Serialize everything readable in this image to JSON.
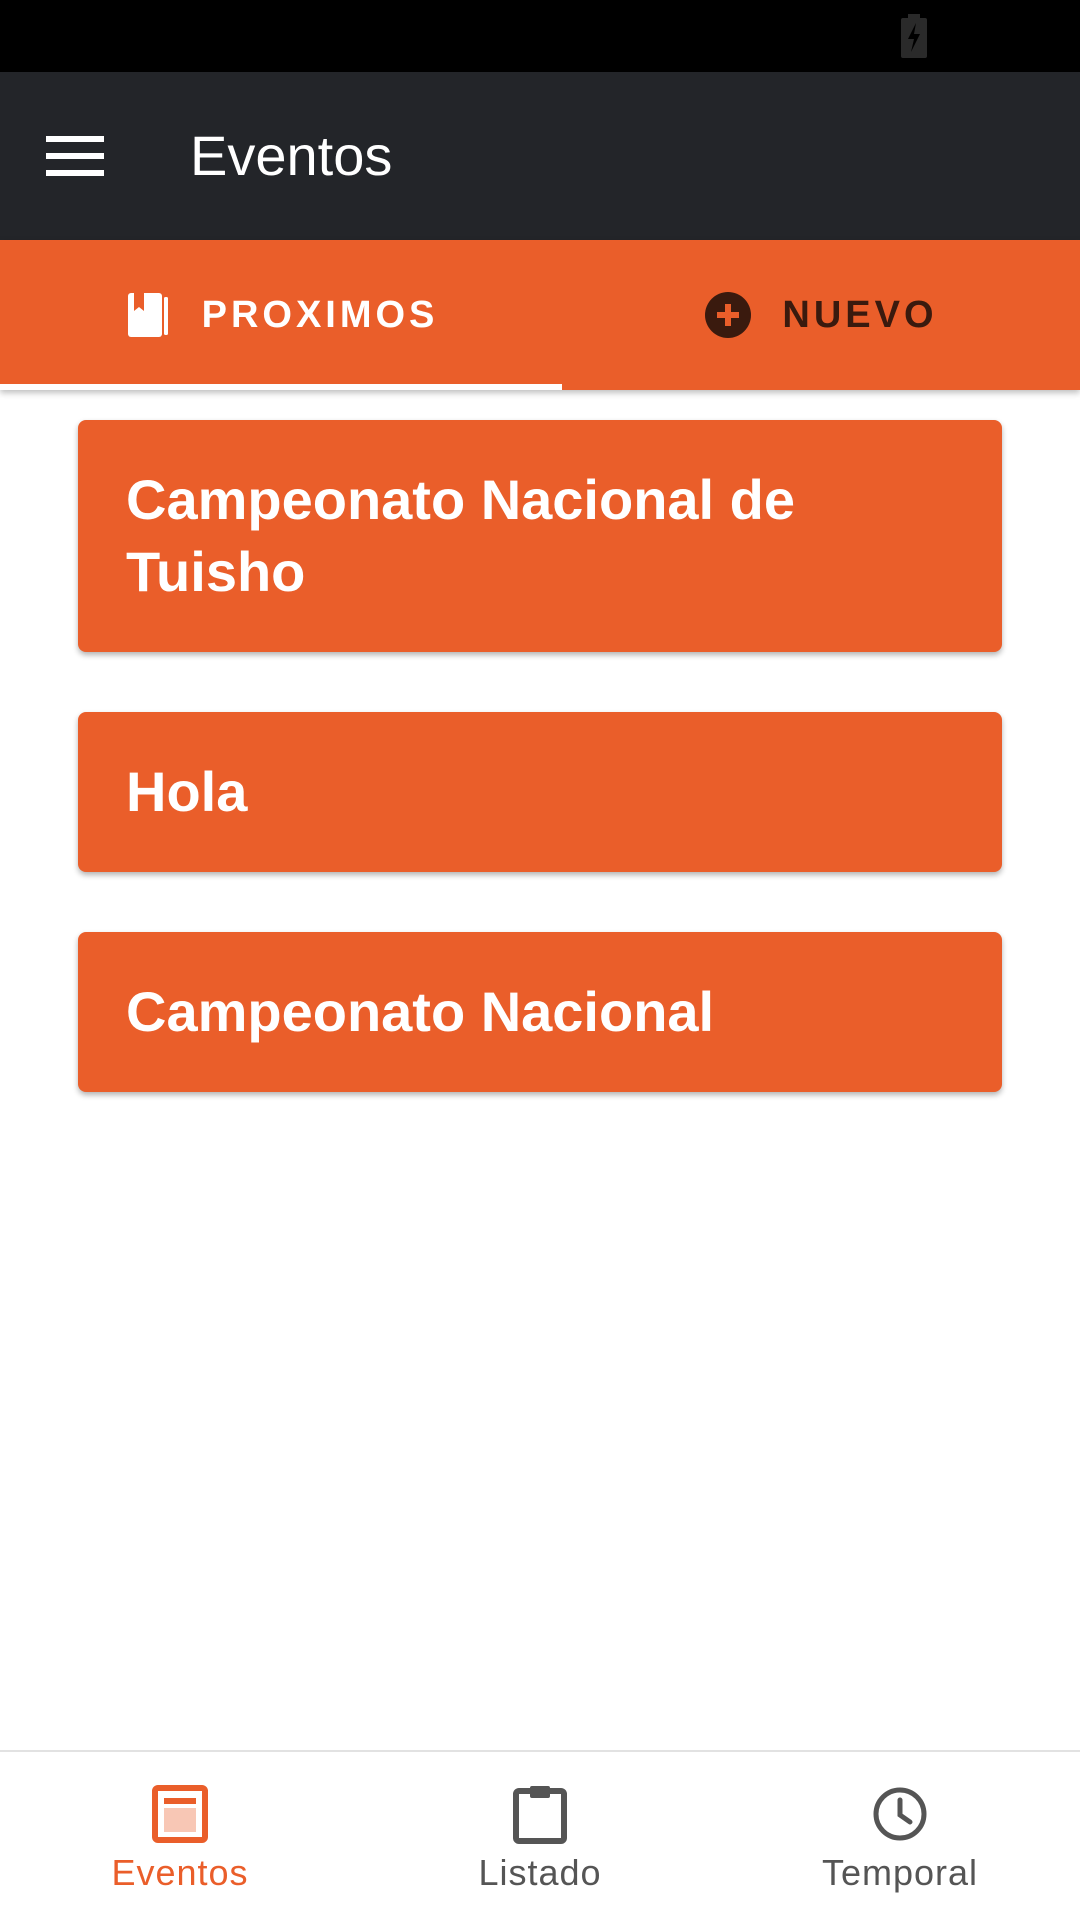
{
  "app_bar": {
    "title": "Eventos",
    "menu_icon": "hamburger-menu-icon",
    "color": "#232529"
  },
  "status_bar": {
    "battery_icon": "battery-charging-icon"
  },
  "tabs": [
    {
      "label": "PROXIMOS",
      "icon": "book-icon",
      "selected": true
    },
    {
      "label": "NUEVO",
      "icon": "add-circle-icon",
      "selected": false
    }
  ],
  "events": [
    {
      "title": "Campeonato Nacional de Tuisho"
    },
    {
      "title": "Hola"
    },
    {
      "title": "Campeonato Nacional"
    }
  ],
  "bottom_nav": [
    {
      "label": "Eventos",
      "icon": "event-page-icon",
      "active": true
    },
    {
      "label": "Listado",
      "icon": "clipboard-icon",
      "active": false
    },
    {
      "label": "Temporal",
      "icon": "clock-icon",
      "active": false
    }
  ],
  "colors": {
    "accent": "#ea5e2a",
    "app_bar": "#232529",
    "inactive_text": "#555555"
  }
}
